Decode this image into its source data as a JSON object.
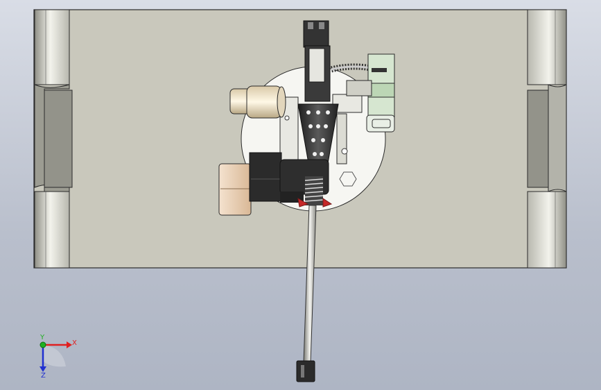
{
  "viewport": {
    "background_top": "#d9dde6",
    "background_bottom": "#aeb5c4"
  },
  "model": {
    "base_plate_color": "#c9c8bc",
    "outline_color": "#2a2a2a",
    "cylinder_light": "#f2f2ea",
    "cylinder_dark": "#8f8f86",
    "knob_color": "#e9d1b8",
    "black_part_color": "#2b2b2b",
    "accent_red": "#c62828",
    "accent_green": "#bcd6b5"
  },
  "triad": {
    "x_label": "X",
    "y_label": "Y",
    "z_label": "Z",
    "x_color": "#e02020",
    "y_color": "#20b020",
    "z_color": "#2030d0"
  }
}
